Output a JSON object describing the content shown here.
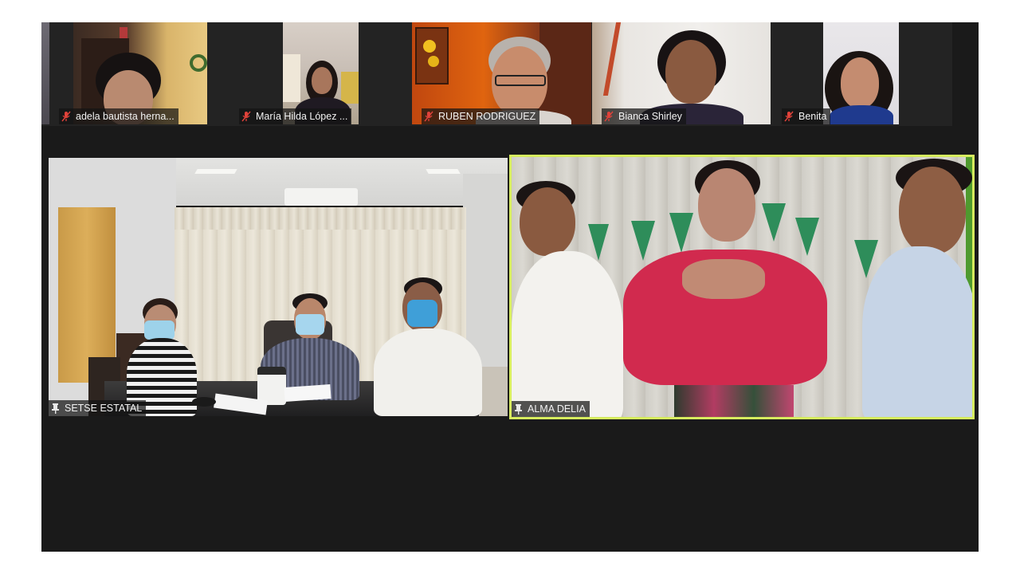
{
  "meeting": {
    "participants_strip": [
      {
        "name": "adela bautista herna...",
        "muted": true
      },
      {
        "name": "María Hilda López ...",
        "muted": true
      },
      {
        "name": "RUBEN RODRIGUEZ",
        "muted": true
      },
      {
        "name": "Bianca Shirley",
        "muted": true
      },
      {
        "name": "Benita",
        "muted": true
      }
    ],
    "main_tiles": [
      {
        "name": "SETSE ESTATAL",
        "pinned": true,
        "active_speaker": false
      },
      {
        "name": "ALMA DELIA",
        "pinned": true,
        "active_speaker": true
      }
    ]
  },
  "colors": {
    "background": "#1a1a1a",
    "active_speaker_border": "#d6ec5e",
    "muted_icon": "#e0423a"
  }
}
